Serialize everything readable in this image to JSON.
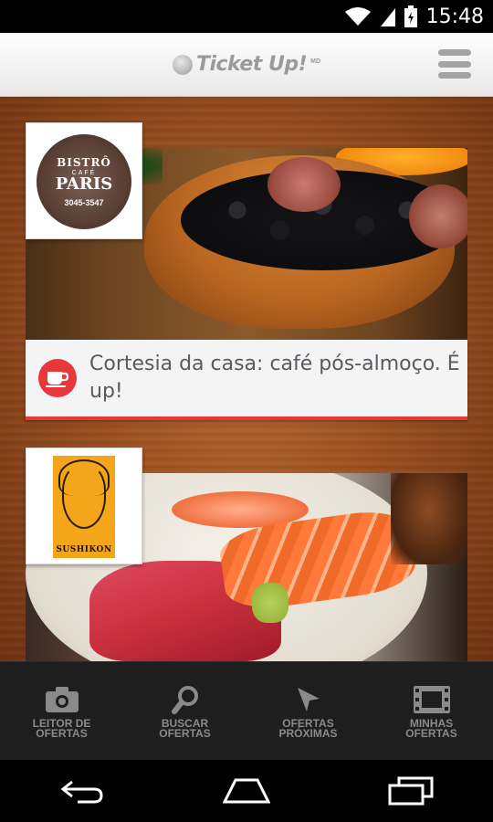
{
  "status_bar": {
    "time": "15:48"
  },
  "header": {
    "logo_text": "Ticket Up!",
    "logo_mark": "MD",
    "menu_icon": "hamburger-icon"
  },
  "cards": [
    {
      "logo": {
        "name_top": "BISTRÔ",
        "name_sub": "CAFÉ",
        "name": "PARIS",
        "phone": "3045-3547"
      },
      "offer": "Cortesia da casa: café pós-almoço. É up!",
      "offer_icon": "coffee-cup-icon"
    },
    {
      "logo": {
        "name": "SUSHIKON"
      }
    }
  ],
  "tabs": [
    {
      "label": "LEITOR DE OFERTAS",
      "icon": "camera-icon"
    },
    {
      "label": "BUSCAR OFERTAS",
      "icon": "search-icon"
    },
    {
      "label": "OFERTAS PRÓXIMAS",
      "icon": "location-arrow-icon"
    },
    {
      "label": "MINHAS OFERTAS",
      "icon": "ticket-icon"
    }
  ],
  "colors": {
    "accent": "#e8383c",
    "tab_bg": "#1e1e1e",
    "tab_fg": "#8a8a8a"
  }
}
